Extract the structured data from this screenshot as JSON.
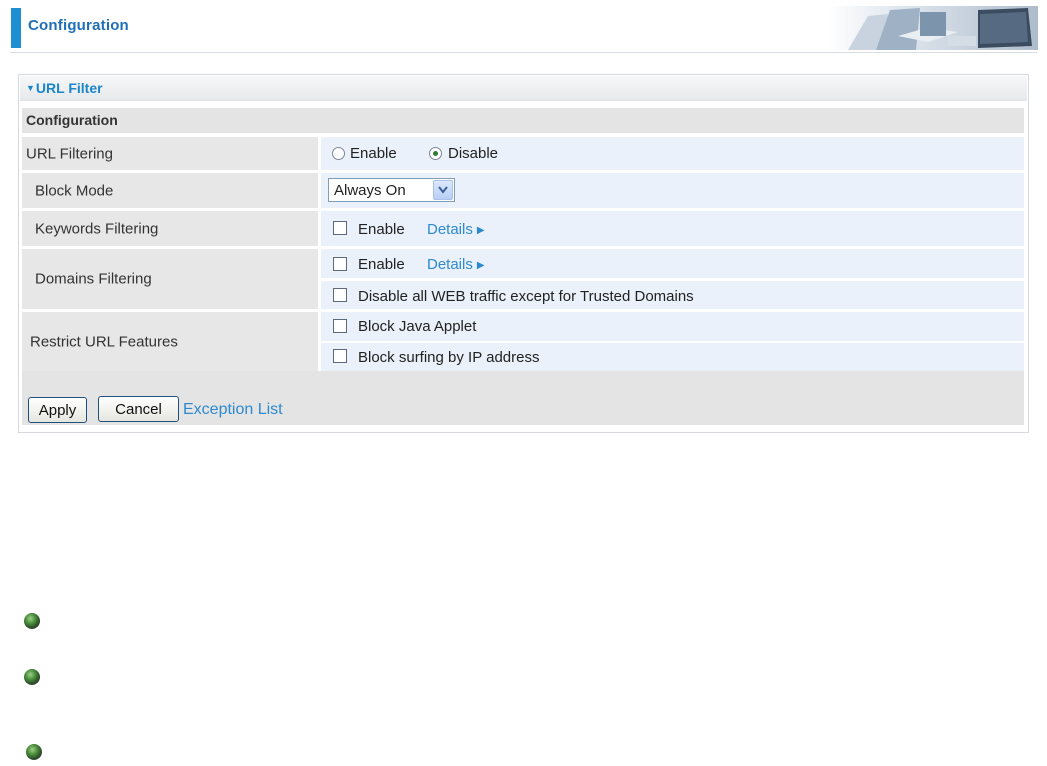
{
  "header": {
    "title": "Configuration"
  },
  "panel": {
    "title": "URL Filter",
    "section": "Configuration",
    "rows": {
      "url_filtering": {
        "label": "URL Filtering",
        "enable": "Enable",
        "disable": "Disable",
        "selected": "Disable"
      },
      "block_mode": {
        "label": "Block Mode",
        "value": "Always On"
      },
      "keywords": {
        "label": "Keywords Filtering",
        "enable": "Enable",
        "details": "Details"
      },
      "domains": {
        "label": "Domains Filtering",
        "enable": "Enable",
        "details": "Details",
        "trusted": "Disable all WEB traffic except for Trusted Domains"
      },
      "restrict": {
        "label": "Restrict URL Features",
        "java": "Block Java Applet",
        "ip": "Block surfing by IP address"
      }
    },
    "footer": {
      "apply": "Apply",
      "cancel": "Cancel",
      "exception": "Exception List"
    }
  },
  "colors": {
    "accent": "#1f8fd3",
    "link": "#2d8ad0",
    "label_bg": "#e7e7e7",
    "value_bg": "#eaf1fa"
  }
}
